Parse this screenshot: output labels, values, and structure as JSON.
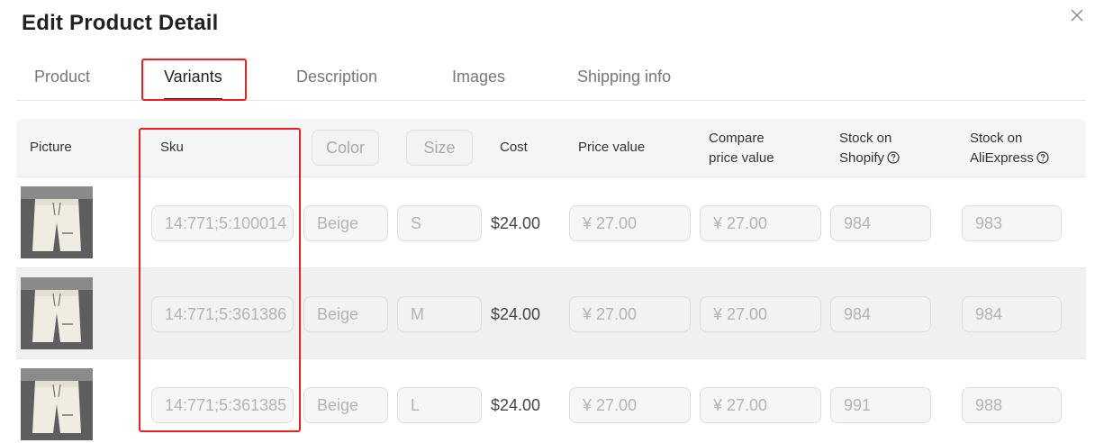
{
  "modal": {
    "title": "Edit Product Detail",
    "close_glyph": "×"
  },
  "tabs": [
    {
      "label": "Product",
      "active": false
    },
    {
      "label": "Variants",
      "active": true
    },
    {
      "label": "Description",
      "active": false
    },
    {
      "label": "Images",
      "active": false
    },
    {
      "label": "Shipping info",
      "active": false
    }
  ],
  "table": {
    "headers": {
      "picture": "Picture",
      "sku": "Sku",
      "color": "Color",
      "size": "Size",
      "cost": "Cost",
      "price_value": "Price value",
      "compare_line1": "Compare",
      "compare_line2": "price value",
      "stock_shopify_line1": "Stock on",
      "stock_shopify_line2": "Shopify",
      "stock_ali_line1": "Stock on",
      "stock_ali_line2": "AliExpress"
    },
    "rows": [
      {
        "sku": "14:771;5:100014",
        "color": "Beige",
        "size": "S",
        "cost": "$24.00",
        "price": "¥ 27.00",
        "compare": "¥ 27.00",
        "stock_shopify": "984",
        "stock_ali": "983"
      },
      {
        "sku": "14:771;5:361386",
        "color": "Beige",
        "size": "M",
        "cost": "$24.00",
        "price": "¥ 27.00",
        "compare": "¥ 27.00",
        "stock_shopify": "984",
        "stock_ali": "984"
      },
      {
        "sku": "14:771;5:361385",
        "color": "Beige",
        "size": "L",
        "cost": "$24.00",
        "price": "¥ 27.00",
        "compare": "¥ 27.00",
        "stock_shopify": "991",
        "stock_ali": "988"
      }
    ]
  },
  "icons": {
    "close": "close-icon",
    "help": "question-circle-icon",
    "thumbnail": "product-shorts-thumbnail"
  },
  "colors": {
    "highlight": "#f02020",
    "active_tab": "#222222"
  }
}
